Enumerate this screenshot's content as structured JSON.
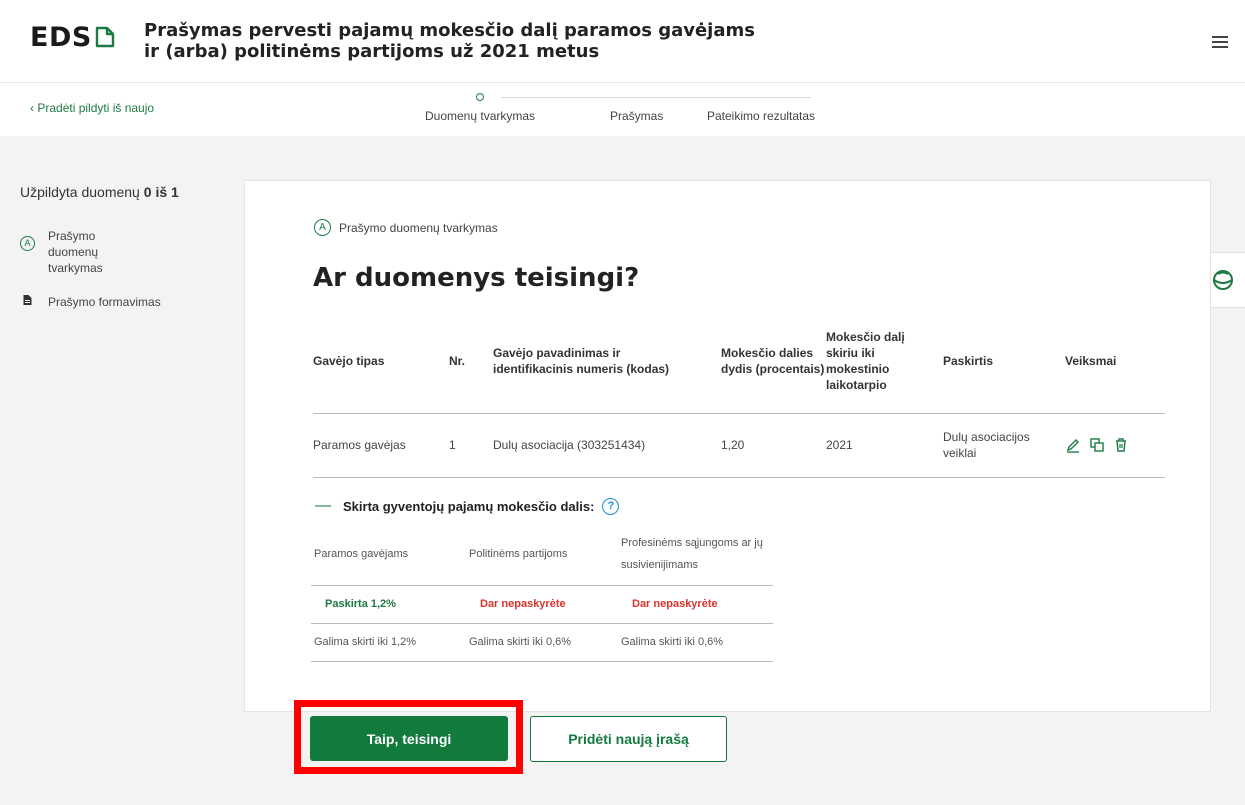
{
  "header": {
    "logo_text": "EDS",
    "title_line1": "Prašymas pervesti pajamų mokesčio dalį paramos gavėjams",
    "title_line2": "ir (arba) politinėms partijoms už 2021 metus",
    "menu_icon": "hamburger-menu-icon"
  },
  "subnav": {
    "back_label": "Pradėti pildyti iš naujo",
    "steps": [
      {
        "label": "Duomenų tvarkymas",
        "active": true
      },
      {
        "label": "Prašymas",
        "active": false
      },
      {
        "label": "Pateikimo rezultatas",
        "active": false
      }
    ]
  },
  "sidebar": {
    "progress_prefix": "Užpildyta duomenų",
    "progress_filled": "0",
    "progress_sep": "iš",
    "progress_total": "1",
    "items": [
      {
        "badge": "A",
        "label": "Prašymo duomenų tvarkymas"
      },
      {
        "icon": "document-icon",
        "label": "Prašymo formavimas"
      }
    ]
  },
  "card": {
    "step_badge": "A",
    "step_label": "Prašymo duomenų tvarkymas",
    "title": "Ar duomenys teisingi?"
  },
  "table": {
    "headers": [
      "Gavėjo tipas",
      "Nr.",
      "Gavėjo pavadinimas ir identifikacinis numeris (kodas)",
      "Mokesčio dalies dydis (procentais)",
      "Mokesčio dalį skiriu iki mokestinio laikotarpio",
      "Paskirtis",
      "Veiksmai"
    ],
    "rows": [
      {
        "type": "Paramos gavėjas",
        "nr": "1",
        "name": "Dulų asociacija (303251434)",
        "share": "1,20",
        "until": "2021",
        "purpose": "Dulų asociacijos veiklai",
        "actions": [
          "edit-icon",
          "copy-icon",
          "delete-icon"
        ]
      }
    ]
  },
  "allocation": {
    "toggle_symbol": "—",
    "title": "Skirta gyventojų pajamų mokesčio dalis:",
    "help_symbol": "?",
    "headers": [
      "Paramos gavėjams",
      "Politinėms partijoms",
      "Profesinėms sąjungoms ar jų susivienijimams"
    ],
    "status": [
      "Paskirta 1,2%",
      "Dar nepaskyrėte",
      "Dar nepaskyrėte"
    ],
    "limits": [
      "Galima skirti iki 1,2%",
      "Galima skirti iki 0,6%",
      "Galima skirti iki 0,6%"
    ]
  },
  "buttons": {
    "confirm": "Taip, teisingi",
    "add_new": "Pridėti naują įrašą"
  },
  "colors": {
    "brand_green": "#127a3c",
    "error_red": "#d9342b",
    "highlight_red": "#ff0000",
    "help_blue": "#1f8fd6"
  }
}
